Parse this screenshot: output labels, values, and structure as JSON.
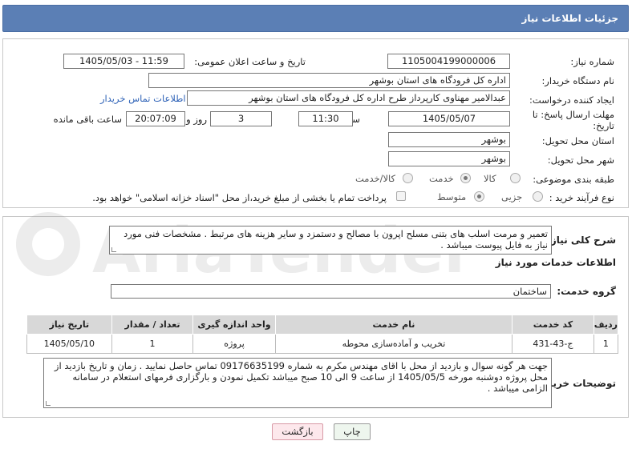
{
  "header": {
    "title": "جزئیات اطلاعات نیاز"
  },
  "labels": {
    "need_number": "شماره نیاز:",
    "announce_datetime": "تاریخ و ساعت اعلان عمومی:",
    "buyer_org": "نام دستگاه خریدار:",
    "requester": "ایجاد کننده درخواست:",
    "deadline": "مهلت ارسال پاسخ: تا تاریخ:",
    "time_word": "ساعت",
    "days_word": "روز و",
    "remaining_word": "ساعت باقی مانده",
    "province": "استان محل تحویل:",
    "city": "شهر محل تحویل:",
    "category": "طبقه بندی موضوعی:",
    "process_type": "نوع فرآیند خرید :",
    "description": "شرح کلی نیاز:",
    "services_info": "اطلاعات خدمات مورد نیاز",
    "service_group": "گروه خدمت:",
    "buyer_notes": "توضیحات خریدار:"
  },
  "fields": {
    "need_number": "1105004199000006",
    "announce_datetime": "1405/05/03 - 11:59",
    "buyer_org": "اداره کل فرودگاه های استان بوشهر",
    "requester": "عبدالامیر مهناوی کارپرداز طرح اداره کل فرودگاه های استان بوشهر",
    "contact_link": "اطلاعات تماس خریدار",
    "deadline_date": "1405/05/07",
    "deadline_time": "11:30",
    "days_remaining": "3",
    "time_remaining": "20:07:09",
    "province": "بوشهر",
    "city": "بوشهر",
    "service_group": "ساختمان"
  },
  "category_options": [
    {
      "label": "کالا",
      "selected": false
    },
    {
      "label": "خدمت",
      "selected": true
    },
    {
      "label": "کالا/خدمت",
      "selected": false
    }
  ],
  "process_options": [
    {
      "label": "جزیی",
      "selected": false
    },
    {
      "label": "متوسط",
      "selected": true
    }
  ],
  "payment_note": "پرداخت تمام یا بخشی از مبلغ خرید،از محل \"اسناد خزانه اسلامی\" خواهد بود.",
  "description_text": "تعمیر و مرمت اسلب های بتنی مسلح اپرون  با مصالح و دستمزد و سایر هزینه های مرتبط . مشخصات فنی مورد نیاز به فایل پیوست میباشد .",
  "table": {
    "headers": [
      "ردیف",
      "کد خدمت",
      "نام خدمت",
      "واحد اندازه گیری",
      "تعداد / مقدار",
      "تاریخ نیاز"
    ],
    "rows": [
      [
        "1",
        "ج-43-431",
        "تخریب و آماده‌سازی محوطه",
        "پروژه",
        "1",
        "1405/05/10"
      ]
    ]
  },
  "buyer_notes_text": "جهت هر گونه سوال و بازدید از محل با اقای مهندس  مکرم به شماره 09176635199 تماس حاصل نمایید . زمان و تاریخ بازدید از محل پروژه دوشنبه مورخه 1405/05/5 از ساعت 9 الی 10 صبح میباشد تکمیل نمودن و بارگزاری فرمهای استعلام در سامانه الزامی میباشد .",
  "buttons": {
    "print": "چاپ",
    "back": "بازگشت"
  },
  "watermark": "AriaTender.net",
  "colors": {
    "header_bg": "#5b7fb5",
    "link": "#2e62b7",
    "print_bg": "#eef6ee",
    "back_bg": "#fde8ec"
  }
}
